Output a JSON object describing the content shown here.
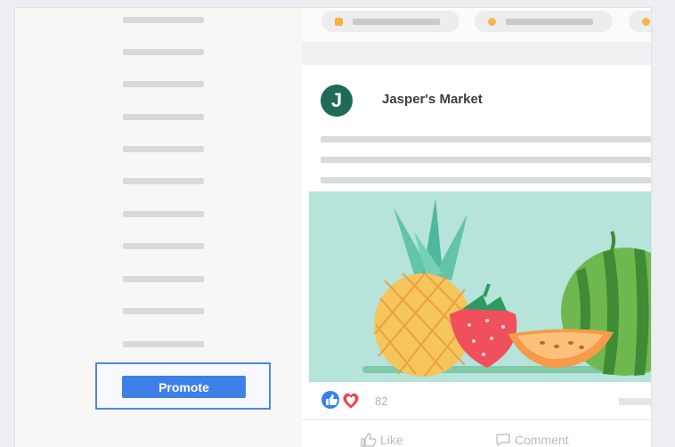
{
  "sidebar": {
    "promote_label": "Promote"
  },
  "post": {
    "page_name": "Jasper's Market",
    "avatar_letter": "J",
    "reaction_count": "82",
    "actions": {
      "like": "Like",
      "comment": "Comment"
    }
  },
  "colors": {
    "accent": "#3f7fe8",
    "avatar": "#1f6a58",
    "image_bg": "#b6e3da"
  }
}
